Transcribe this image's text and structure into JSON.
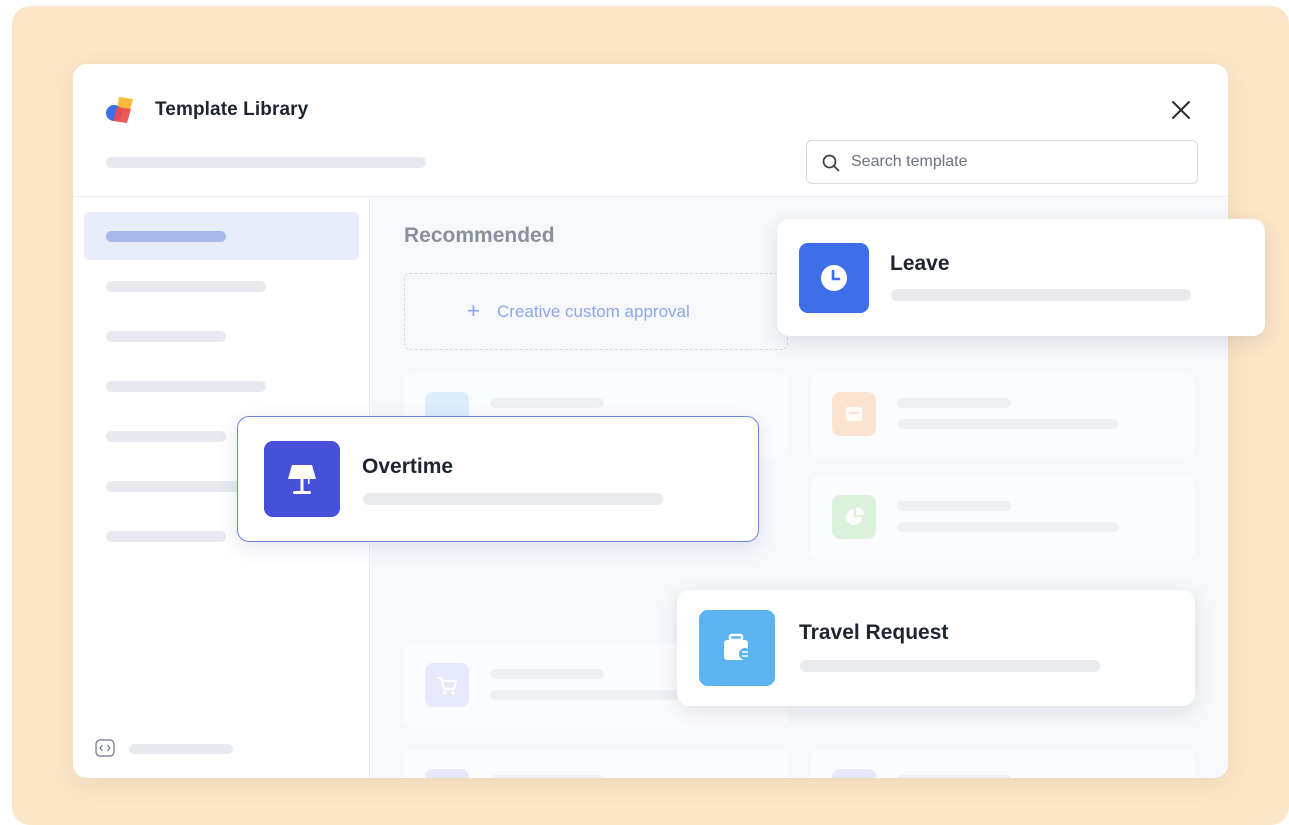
{
  "window": {
    "title": "Template Library",
    "search_placeholder": "Search template"
  },
  "main": {
    "section_title": "Recommended",
    "custom_approval_label": "Creative custom approval"
  },
  "cards": {
    "leave": {
      "name": "Leave",
      "icon": "clock-icon",
      "color": "#3f6fe8"
    },
    "overtime": {
      "name": "Overtime",
      "icon": "lamp-icon",
      "color": "#4650d8"
    },
    "travel": {
      "name": "Travel Request",
      "icon": "briefcase-icon",
      "color": "#5bb4f0"
    }
  },
  "colors": {
    "backdrop": "#fbe6c9",
    "accent": "#3f6fe8",
    "sidebar_active": "#e8edfb"
  }
}
